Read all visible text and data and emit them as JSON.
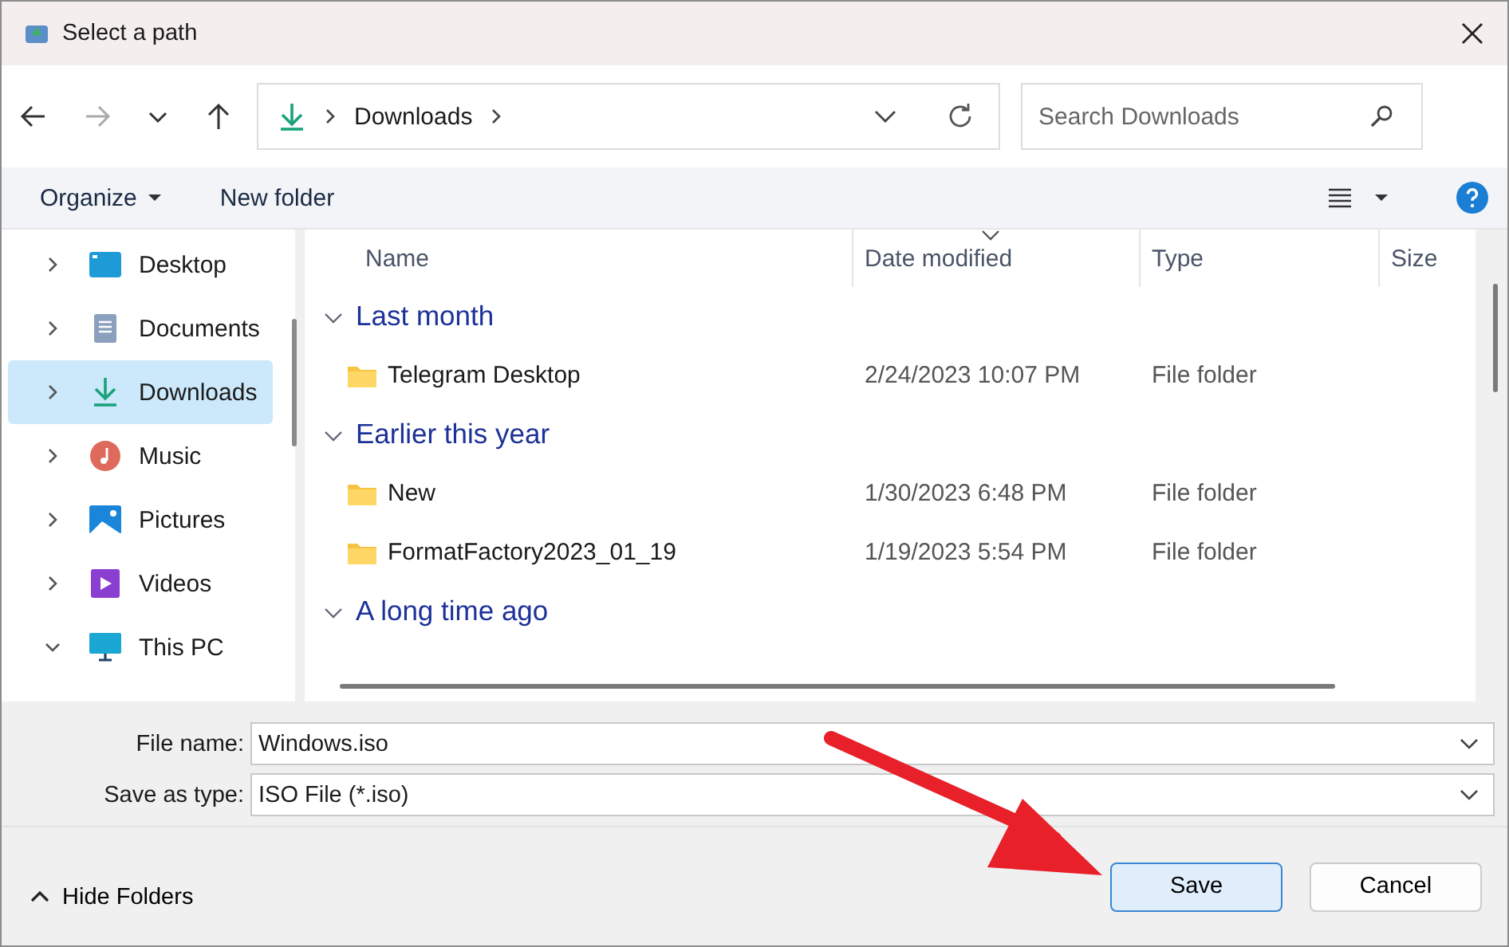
{
  "window": {
    "title": "Select a path"
  },
  "nav": {
    "breadcrumb": [
      "Downloads"
    ],
    "search": {
      "placeholder": "Search Downloads"
    }
  },
  "toolbar": {
    "organize": "Organize",
    "new_folder": "New folder"
  },
  "sidebar": {
    "items": [
      {
        "label": "Desktop",
        "kind": "desktop",
        "selected": false,
        "expanded": false
      },
      {
        "label": "Documents",
        "kind": "documents",
        "selected": false,
        "expanded": false
      },
      {
        "label": "Downloads",
        "kind": "downloads",
        "selected": true,
        "expanded": false
      },
      {
        "label": "Music",
        "kind": "music",
        "selected": false,
        "expanded": false
      },
      {
        "label": "Pictures",
        "kind": "pictures",
        "selected": false,
        "expanded": false
      },
      {
        "label": "Videos",
        "kind": "videos",
        "selected": false,
        "expanded": false
      },
      {
        "label": "This PC",
        "kind": "pc",
        "selected": false,
        "expanded": true
      }
    ]
  },
  "table": {
    "columns": [
      {
        "label": "Name",
        "sorted": false
      },
      {
        "label": "Date modified",
        "sorted": true
      },
      {
        "label": "Type",
        "sorted": false
      },
      {
        "label": "Size",
        "sorted": false
      }
    ],
    "groups": [
      {
        "label": "Last month",
        "expanded": true,
        "rows": [
          {
            "name": "Telegram Desktop",
            "date": "2/24/2023 10:07 PM",
            "type": "File folder"
          }
        ]
      },
      {
        "label": "Earlier this year",
        "expanded": true,
        "rows": [
          {
            "name": "New",
            "date": "1/30/2023 6:48 PM",
            "type": "File folder"
          },
          {
            "name": "FormatFactory2023_01_19",
            "date": "1/19/2023 5:54 PM",
            "type": "File folder"
          }
        ]
      },
      {
        "label": "A long time ago",
        "expanded": true
      }
    ]
  },
  "form": {
    "file_name_label": "File name:",
    "file_name": "Windows.iso",
    "type_label": "Save as type:",
    "type": "ISO File (*.iso)"
  },
  "footer": {
    "hide_folders": "Hide Folders",
    "buttons": [
      {
        "label": "Save",
        "selected": true
      },
      {
        "label": "Cancel",
        "selected": false
      }
    ]
  }
}
